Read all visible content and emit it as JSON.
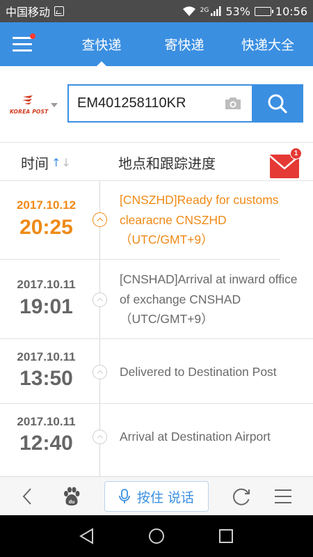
{
  "status_bar": {
    "carrier": "中国移动",
    "network": "2G",
    "battery": "53%",
    "battery_level": 0.53,
    "time": "10:56"
  },
  "nav": {
    "tabs": [
      {
        "label": "查快递",
        "active": true
      },
      {
        "label": "寄快递",
        "active": false
      },
      {
        "label": "快递大全",
        "active": false
      }
    ]
  },
  "search": {
    "carrier_logo_text": "KOREA POST",
    "tracking_number": "EM401258110KR"
  },
  "table": {
    "time_header": "时间",
    "detail_header": "地点和跟踪进度",
    "mail_badge": "1"
  },
  "events": [
    {
      "date": "2017.10.12",
      "time": "20:25",
      "desc": "[CNSZHD]Ready for customs clearacne CNSZHD（UTC/GMT+9）",
      "current": true
    },
    {
      "date": "2017.10.11",
      "time": "19:01",
      "desc": "[CNSHAD]Arrival at inward office of exchange CNSHAD（UTC/GMT+9）",
      "current": false
    },
    {
      "date": "2017.10.11",
      "time": "13:50",
      "desc": "Delivered to Destination Post",
      "current": false
    },
    {
      "date": "2017.10.11",
      "time": "12:40",
      "desc": "Arrival at Destination Airport",
      "current": false
    }
  ],
  "browser_bar": {
    "voice_label": "按住 说话"
  },
  "colors": {
    "brand": "#3b8fe1",
    "highlight": "#ef8a17",
    "badge": "#e53935"
  }
}
